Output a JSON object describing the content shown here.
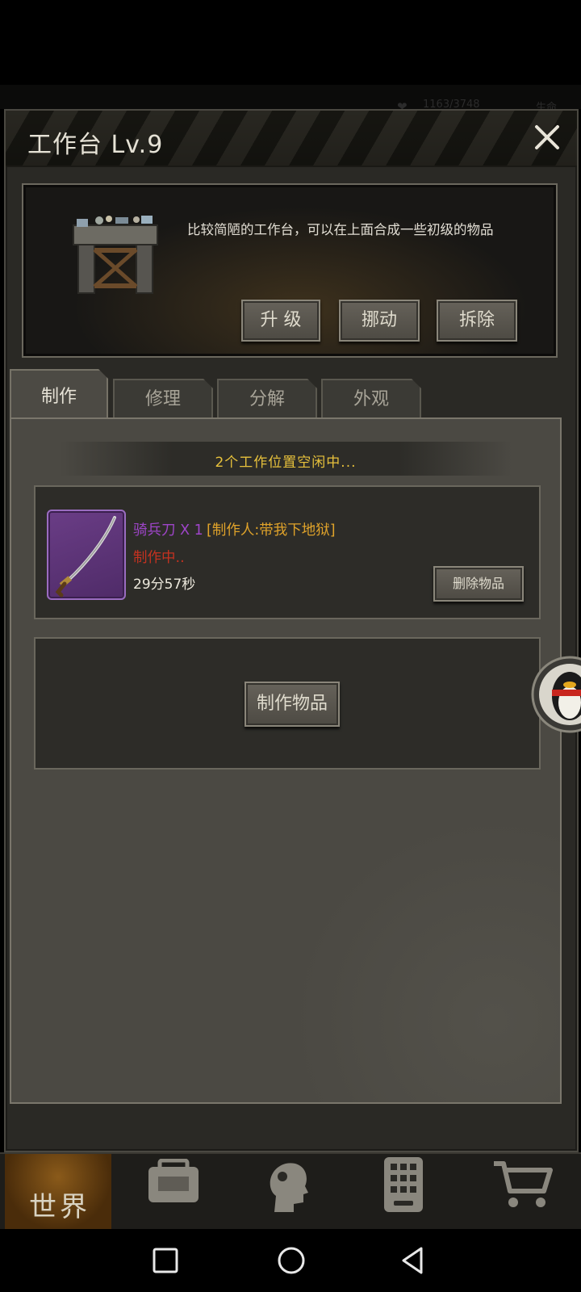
{
  "hud": {
    "stat": "1163/3748",
    "life": "生命"
  },
  "window": {
    "title": "工作台 Lv.9"
  },
  "info": {
    "description": "比较简陋的工作台，可以在上面合成一些初级的物品",
    "buttons": {
      "upgrade": "升 级",
      "move": "挪动",
      "dismantle": "拆除"
    }
  },
  "tabs": [
    {
      "label": "制作",
      "active": true
    },
    {
      "label": "修理"
    },
    {
      "label": "分解"
    },
    {
      "label": "外观"
    }
  ],
  "crafting": {
    "slots_status": "2个工作位置空闲中...",
    "item": {
      "name": "骑兵刀 X 1",
      "maker": "[制作人:带我下地狱]",
      "status": "制作中..",
      "timer": "29分57秒",
      "rarity_color": "#9e45c8",
      "icon": "saber-icon"
    },
    "delete_button": "删除物品",
    "craft_button": "制作物品"
  },
  "nav": {
    "world_label": "世界",
    "items": [
      "backpack-icon",
      "skills-head-icon",
      "phone-icon",
      "shop-cart-icon"
    ]
  },
  "colors": {
    "status_yellow": "#e7c13c",
    "crafting_red": "#c43220",
    "maker_orange": "#e0a32a"
  }
}
